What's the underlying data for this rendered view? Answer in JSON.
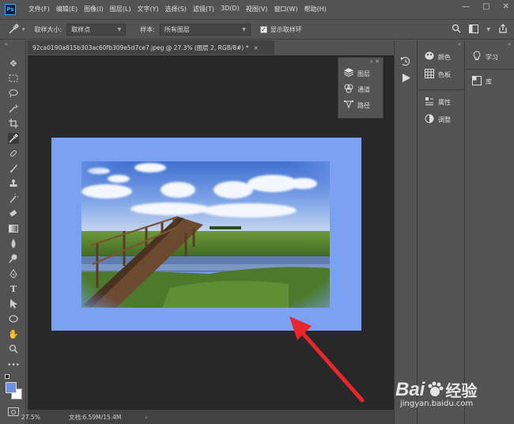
{
  "app": {
    "logo": "Ps"
  },
  "menu": [
    "文件(F)",
    "编辑(E)",
    "图像(I)",
    "图层(L)",
    "文字(Y)",
    "选择(S)",
    "滤镜(T)",
    "3D(D)",
    "视图(V)",
    "窗口(W)",
    "帮助(H)"
  ],
  "window_controls": {
    "minimize": "—",
    "restore": "□",
    "close": "✕"
  },
  "options_bar": {
    "sample_size_label": "取样大小:",
    "sample_size_value": "取样点",
    "sample_label": "样本:",
    "sample_value": "所有图层",
    "show_ring_label": "显示取样环",
    "show_ring_checked": true
  },
  "document": {
    "tab_title": "92ca0190a815b303ac60fb309e5d7ce7.jpeg @ 27.3% (图层 2, RGB/8#) *",
    "tab_close": "×",
    "zoom": "27.5%",
    "doc_size": "文档:6.59M/15.4M",
    "canvas_color": "#7ba1f2"
  },
  "float_panel": {
    "items": [
      {
        "icon": "layers-icon",
        "label": "图层"
      },
      {
        "icon": "channels-icon",
        "label": "通道"
      },
      {
        "icon": "paths-icon",
        "label": "路径"
      }
    ]
  },
  "right_panels": {
    "column1": [
      {
        "icon": "color-icon",
        "label": "颜色"
      },
      {
        "icon": "swatches-icon",
        "label": "色板"
      },
      {
        "icon": "properties-icon",
        "label": "属性"
      },
      {
        "icon": "adjustments-icon",
        "label": "调整"
      }
    ],
    "column2": [
      {
        "icon": "learn-icon",
        "label": "学习"
      },
      {
        "icon": "libraries-icon",
        "label": "库"
      }
    ]
  },
  "watermark": {
    "brand": "Bai",
    "brand2": "经验",
    "url": "jingyan.baidu.com"
  },
  "colors": {
    "accent": "#31a8ff",
    "arrow": "#e8262b",
    "foreground": "#6f8fdf",
    "background": "#ffffff"
  }
}
